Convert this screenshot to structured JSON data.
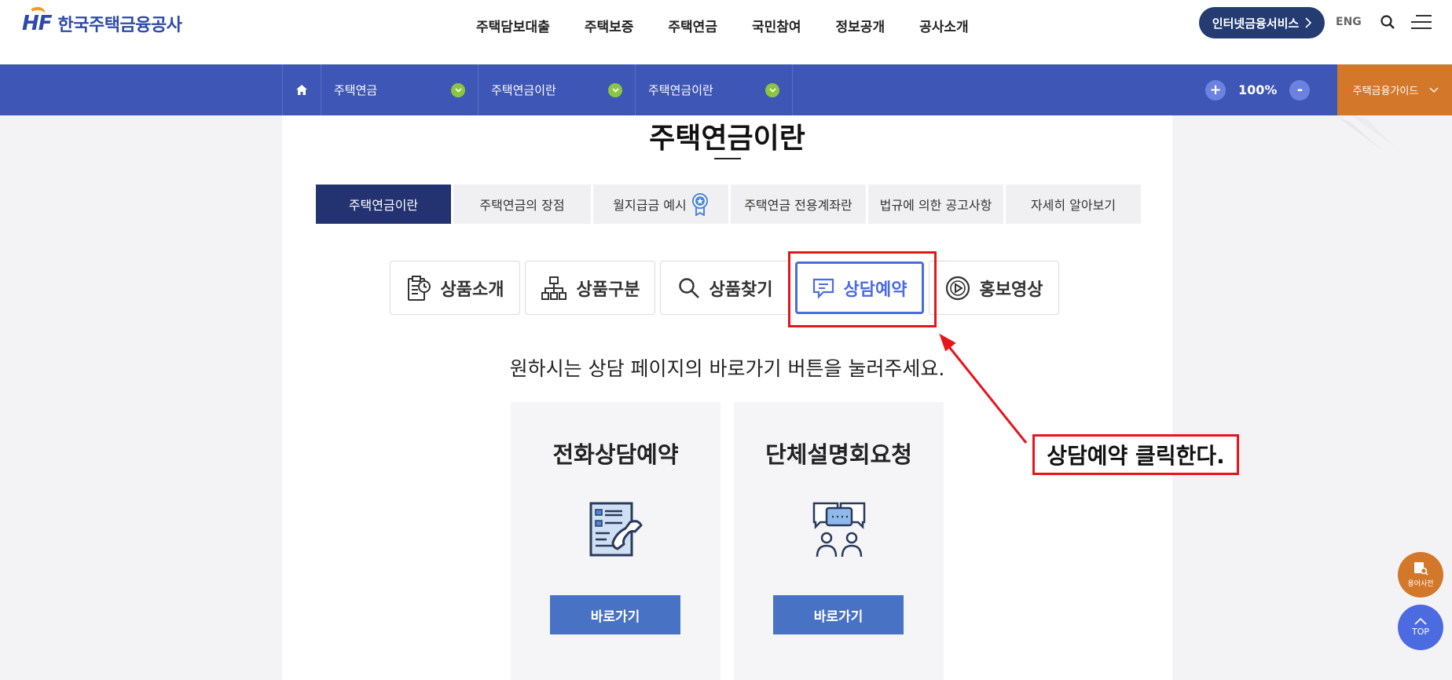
{
  "header": {
    "logo_mark": "HF",
    "logo_text": "한국주택금융공사",
    "gnb": [
      "주택담보대출",
      "주택보증",
      "주택연금",
      "국민참여",
      "정보공개",
      "공사소개"
    ],
    "internet_service_label": "인터넷금융서비스",
    "eng_label": "ENG",
    "icons": {
      "search": "search-icon",
      "menu": "hamburger-menu-icon"
    }
  },
  "location_bar": {
    "selects": [
      "주택연금",
      "주택연금이란",
      "주택연금이란"
    ],
    "zoom_plus": "+",
    "zoom_level": "100%",
    "zoom_minus": "-",
    "guide_label": "주택금융가이드"
  },
  "page": {
    "title": "주택연금이란",
    "tabs": [
      "주택연금이란",
      "주택연금의 장점",
      "월지급금 예시",
      "주택연금 전용계좌란",
      "법규에 의한 공고사항",
      "자세히 알아보기"
    ],
    "active_tab": 0,
    "subtabs": [
      "상품소개",
      "상품구분",
      "상품찾기",
      "상담예약",
      "홍보영상"
    ],
    "active_subtab": 3,
    "guide_text": "원하시는 상담 페이지의 바로가기 버튼을 눌러주세요.",
    "cards": [
      {
        "title": "전화상담예약",
        "button": "바로가기",
        "icon": "phone-checklist-icon"
      },
      {
        "title": "단체설명회요청",
        "button": "바로가기",
        "icon": "group-meeting-icon"
      }
    ]
  },
  "annotation": {
    "label": "상담예약 클릭한다.",
    "color": "#e8141b"
  },
  "floating": {
    "dict_label": "용어사전",
    "top_label": "TOP"
  },
  "colors": {
    "brand_blue": "#3e56b6",
    "navy": "#233270",
    "orange": "#d3772a",
    "active_subtab": "#4d6be0",
    "card_button": "#4872c4"
  }
}
